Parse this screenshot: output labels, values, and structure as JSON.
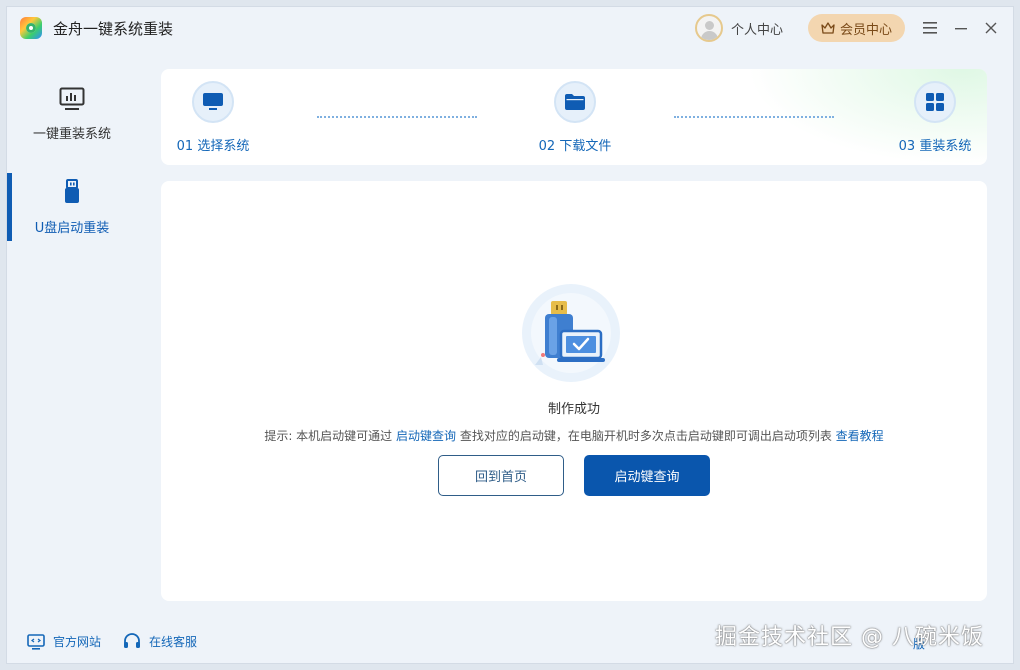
{
  "app": {
    "title": "金舟一键系统重装"
  },
  "header": {
    "user_center": "个人中心",
    "vip_center": "会员中心"
  },
  "sidebar": {
    "items": [
      {
        "label": "一键重装系统",
        "icon": "monitor-chart-icon",
        "active": false
      },
      {
        "label": "U盘启动重装",
        "icon": "usb-drive-icon",
        "active": true
      }
    ]
  },
  "steps": [
    {
      "label": "01 选择系统",
      "icon": "monitor-icon"
    },
    {
      "label": "02 下载文件",
      "icon": "folder-icon"
    },
    {
      "label": "03 重装系统",
      "icon": "windows-icon"
    }
  ],
  "main": {
    "status": "制作成功",
    "hint_prefix": "提示: 本机启动键可通过 ",
    "hint_link": "启动键查询",
    "hint_middle": " 查找对应的启动键，在电脑开机时多次点击启动键即可调出启动项列表 ",
    "hint_link2": "查看教程",
    "btn_home": "回到首页",
    "btn_query": "启动键查询"
  },
  "footer": {
    "official_site": "官方网站",
    "online_service": "在线客服",
    "watermark": "掘金技术社区 @ 八碗米饭",
    "version": "版"
  },
  "colors": {
    "accent": "#0f5cb3",
    "primary_button": "#0a56ad",
    "vip": "#f3d6b0"
  }
}
